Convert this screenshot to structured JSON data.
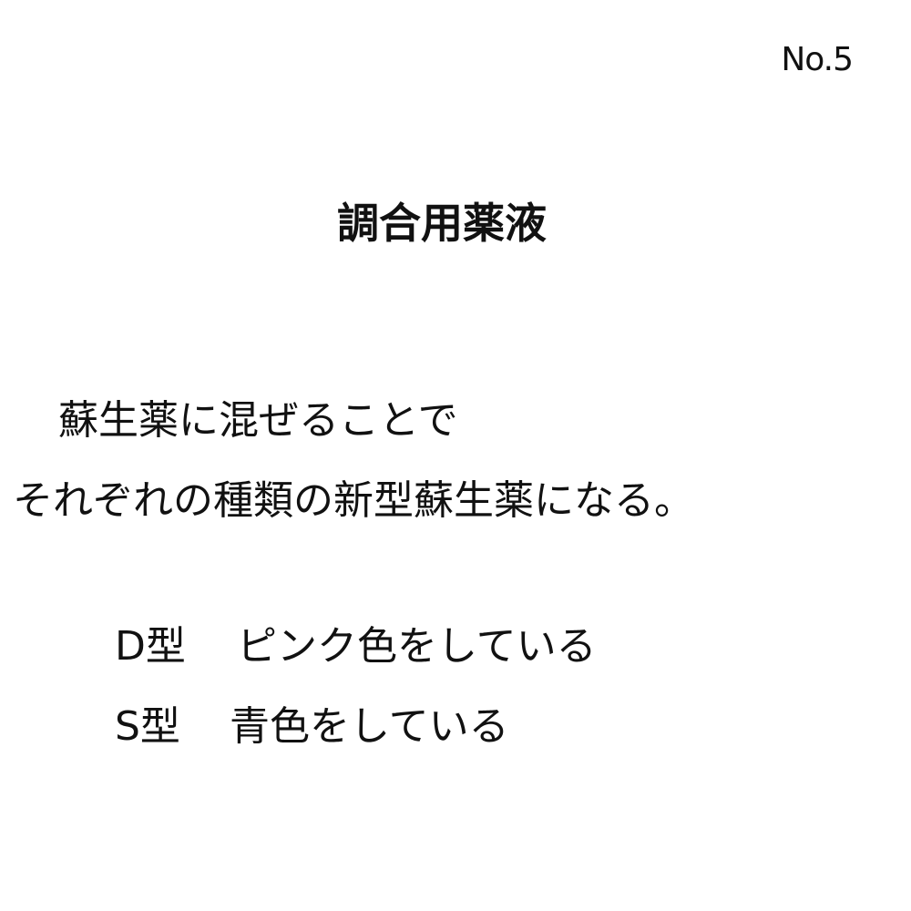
{
  "page_number": "No.5",
  "title": "調合用薬液",
  "description": {
    "lines": [
      "蘇生薬に混ぜることで",
      "それぞれの種類の新型蘇生薬になる。"
    ]
  },
  "types": [
    {
      "name": "D型",
      "color_text": "ピンク色をしている",
      "color": "#ff9ec8"
    },
    {
      "name": "S型",
      "color_text": "青色をしている",
      "color": "#3a7bd5"
    }
  ]
}
